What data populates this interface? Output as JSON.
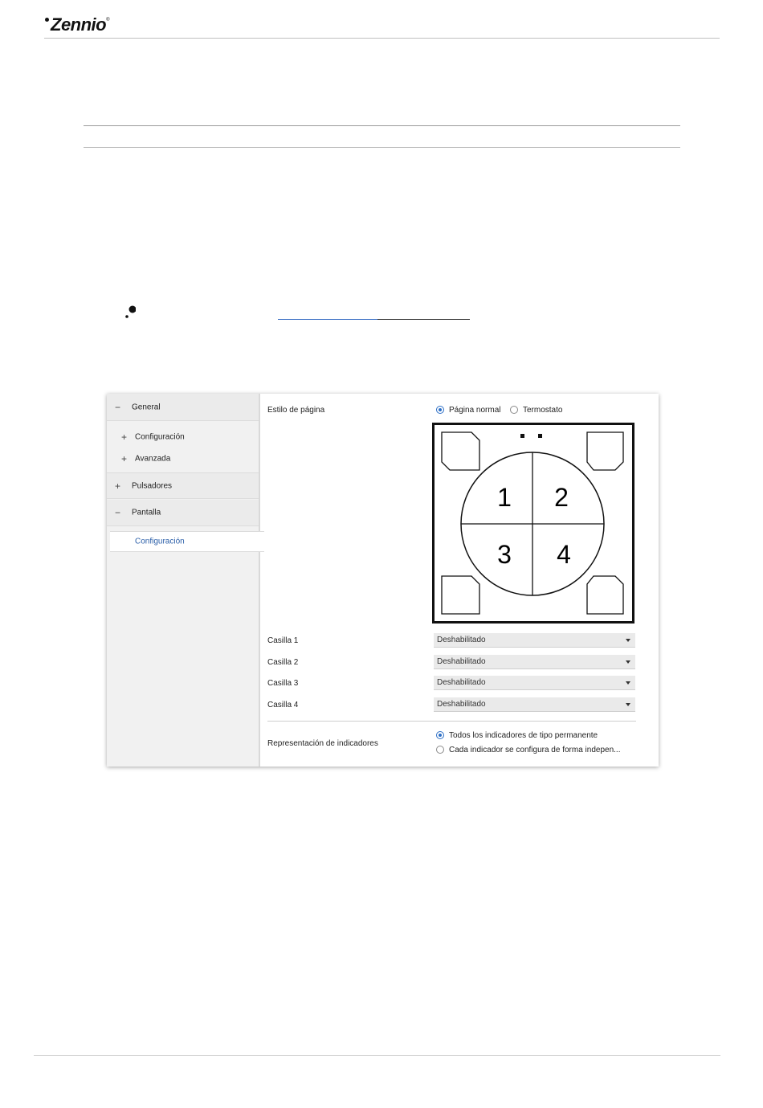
{
  "header": {
    "brand": "Zennio",
    "registered": "®"
  },
  "figure": {
    "tree": {
      "items": [
        {
          "symbol": "−",
          "label": "General"
        },
        {
          "symbol": "+",
          "label": "Configuración"
        },
        {
          "symbol": "+",
          "label": "Avanzada"
        },
        {
          "symbol": "+",
          "label": "Pulsadores"
        },
        {
          "symbol": "−",
          "label": "Pantalla"
        },
        {
          "symbol": "",
          "label": "Configuración"
        }
      ]
    },
    "panel": {
      "page_style": {
        "label": "Estilo de página",
        "options": [
          "Página normal",
          "Termostato"
        ],
        "selected": "Página normal"
      },
      "diagram": {
        "cells": [
          "1",
          "2",
          "3",
          "4"
        ]
      },
      "casillas": [
        {
          "label": "Casilla 1",
          "value": "Deshabilitado"
        },
        {
          "label": "Casilla 2",
          "value": "Deshabilitado"
        },
        {
          "label": "Casilla 3",
          "value": "Deshabilitado"
        },
        {
          "label": "Casilla 4",
          "value": "Deshabilitado"
        }
      ],
      "indicators": {
        "label": "Representación de indicadores",
        "options": [
          "Todos los indicadores de tipo permanente",
          "Cada indicador se configura de forma indepen..."
        ],
        "selected": "Todos los indicadores de tipo permanente"
      }
    }
  }
}
